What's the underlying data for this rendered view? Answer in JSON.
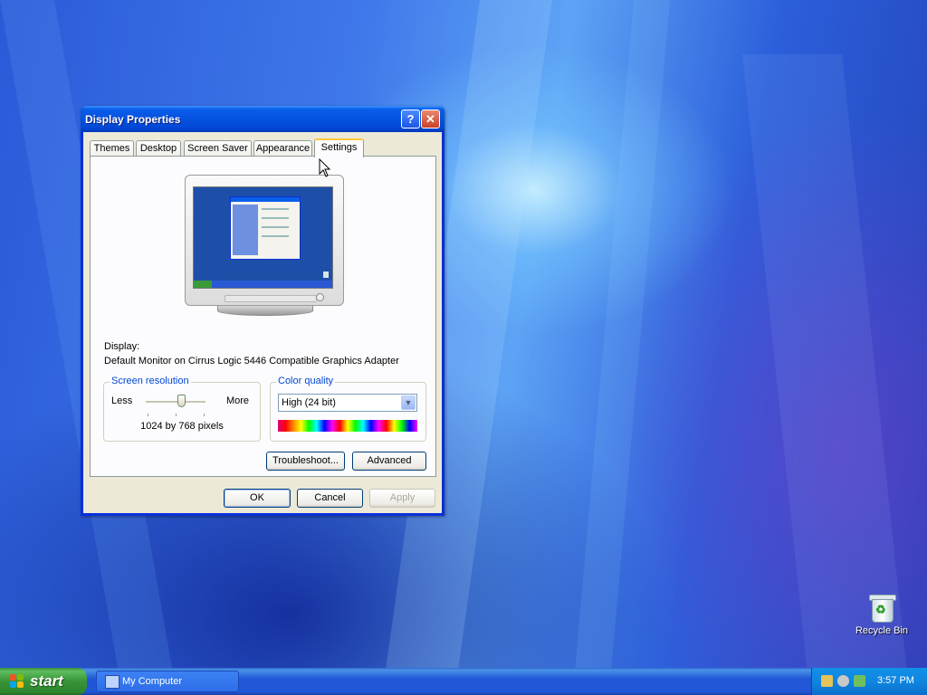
{
  "window": {
    "title": "Display Properties",
    "help_glyph": "?",
    "close_glyph": "✕"
  },
  "tabs": [
    "Themes",
    "Desktop",
    "Screen Saver",
    "Appearance",
    "Settings"
  ],
  "active_tab": "Settings",
  "display": {
    "label": "Display:",
    "value": "Default Monitor on Cirrus Logic 5446 Compatible Graphics Adapter"
  },
  "resolution": {
    "title": "Screen resolution",
    "less_label": "Less",
    "more_label": "More",
    "value_text": "1024 by 768 pixels",
    "slider_level": 0.6
  },
  "color_quality": {
    "title": "Color quality",
    "selected": "High (24 bit)"
  },
  "buttons": {
    "troubleshoot": "Troubleshoot...",
    "advanced": "Advanced",
    "ok": "OK",
    "cancel": "Cancel",
    "apply": "Apply"
  },
  "desktop": {
    "recycle_bin_label": "Recycle Bin"
  },
  "taskbar": {
    "start_label": "start",
    "task_items": [
      "My Computer"
    ],
    "clock": "3:57 PM"
  },
  "icons": {
    "help": "help-icon",
    "close": "close-icon",
    "dropdown": "chevron-down-icon",
    "start_flag": "windows-flag-icon",
    "task": "my-computer-icon",
    "recycle": "recycle-bin-icon"
  },
  "colors": {
    "titlebar_blue": "#0552e0",
    "group_title": "#0046d5",
    "start_green": "#379437",
    "dialog_bg": "#ece9d8",
    "active_tab_highlight": "#ffc73c"
  }
}
